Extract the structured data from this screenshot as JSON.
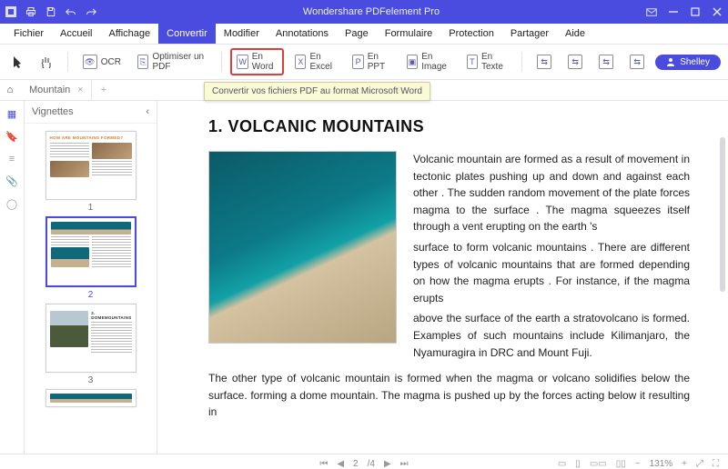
{
  "titlebar": {
    "title": "Wondershare PDFelement Pro"
  },
  "menu": {
    "items": [
      "Fichier",
      "Accueil",
      "Affichage",
      "Convertir",
      "Modifier",
      "Annotations",
      "Page",
      "Formulaire",
      "Protection",
      "Partager",
      "Aide"
    ],
    "active": 3
  },
  "ribbon": {
    "ocr": "OCR",
    "optimize": "Optimiser un PDF",
    "to_word": "En Word",
    "to_excel": "En Excel",
    "to_ppt": "En PPT",
    "to_image": "En Image",
    "to_text": "En Texte",
    "user": "Shelley",
    "tooltip": "Convertir vos fichiers PDF au format Microsoft Word"
  },
  "doc_tab": {
    "name": "Mountain",
    "close": "×",
    "plus": "+"
  },
  "thumbs": {
    "header": "Vignettes",
    "chev": "‹",
    "pages": [
      "1",
      "2",
      "3"
    ],
    "selected": 1
  },
  "article": {
    "heading": "1. VOLCANIC MOUNTAINS",
    "p1": "Volcanic mountain are formed as a result of movement in tectonic plates pushing up and down and against each other . The sudden random movement of the plate forces magma to the surface . The magma squeezes itself through a vent erupting on the earth 's",
    "p2": "surface to form volcanic mountains . There are different types of volcanic mountains that are formed depending on how the magma erupts . For instance, if the magma erupts",
    "p3": "above the surface of the earth a stratovolcano is formed. Examples of such mountains include Kilimanjaro, the Nyamuragira in DRC and Mount Fuji.",
    "p4": "The other type of volcanic mountain is formed when the magma or volcano solidifies below the surface. forming a dome mountain. The magma is pushed up by the forces acting below it resulting in"
  },
  "status": {
    "page_cur": "2",
    "page_sep": "/4",
    "zoom": "131%"
  }
}
